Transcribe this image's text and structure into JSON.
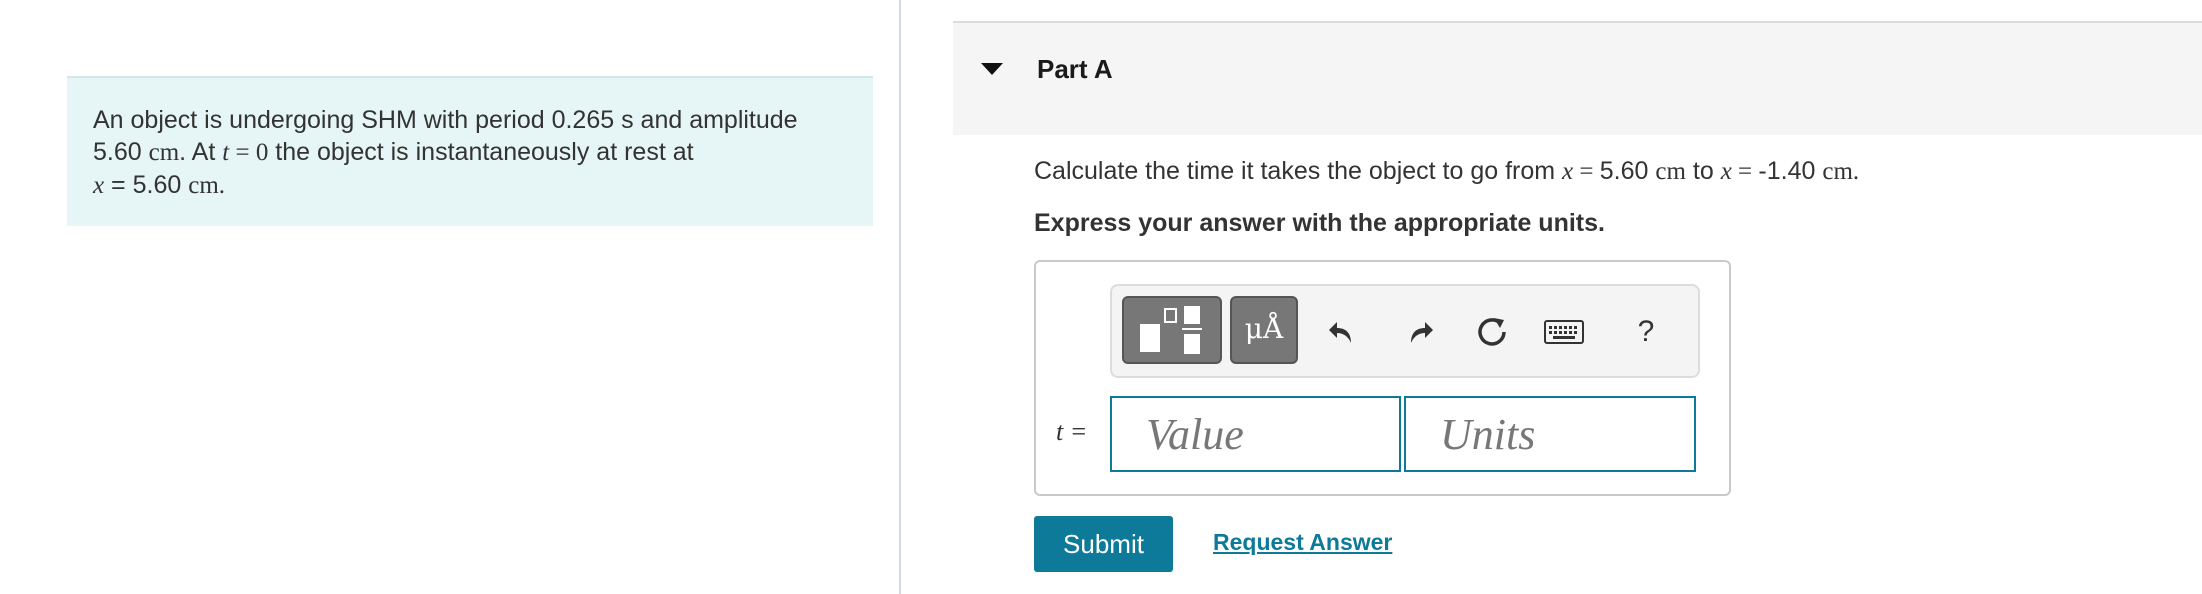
{
  "problem": {
    "text_1": "An object is undergoing SHM with period 0.265 s and amplitude",
    "amplitude": "5.60",
    "unit_cm": "cm",
    "text_2": ". At ",
    "t_var": "t",
    "eq": " = ",
    "zero": "0",
    "text_3": " the object is instantaneously at rest at",
    "x_var": "x",
    "x_eq": " = 5.60 ",
    "text_end": "."
  },
  "part": {
    "title": "Part A",
    "question_1": "Calculate the time it takes the object to go from ",
    "x_var": "x",
    "eq": " = ",
    "from_value": "5.60",
    "unit_cm": "cm",
    "question_2": " to ",
    "to_value": "-1.40",
    "end": ".",
    "instruction": "Express your answer with the appropriate units."
  },
  "toolbar": {
    "units_glyph": "μÅ",
    "help_label": "?",
    "icons": [
      "templates-icon",
      "units-icon",
      "undo-icon",
      "redo-icon",
      "reset-icon",
      "keyboard-icon",
      "help-icon"
    ]
  },
  "answer": {
    "label": "t =",
    "value_placeholder": "Value",
    "units_placeholder": "Units"
  },
  "actions": {
    "submit_label": "Submit",
    "request_label": "Request Answer"
  },
  "colors": {
    "accent": "#0d7a9a",
    "problem_bg": "#e6f5f5",
    "header_bg": "#f5f5f5"
  }
}
